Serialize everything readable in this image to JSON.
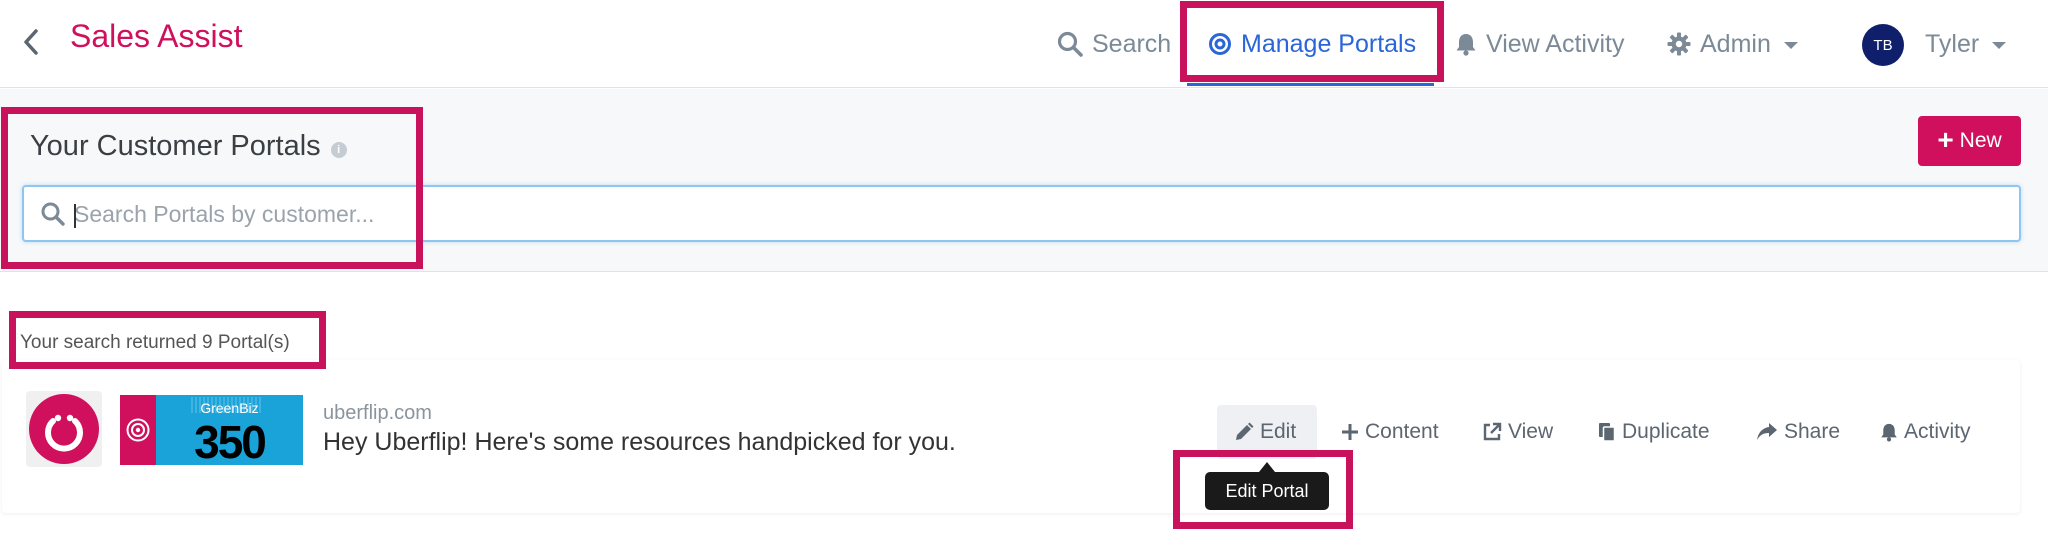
{
  "app": {
    "title": "Sales Assist"
  },
  "nav": {
    "search": "Search",
    "manage_portals": "Manage Portals",
    "view_activity": "View Activity",
    "admin": "Admin",
    "user_initials": "TB",
    "user_name": "Tyler"
  },
  "portals": {
    "title": "Your Customer Portals",
    "info_glyph": "i",
    "new_label": "New",
    "search_placeholder": "Search Portals by customer...",
    "search_value": "",
    "results_text": "Your search returned 9 Portal(s)"
  },
  "portal_card": {
    "domain": "uberflip.com",
    "description": "Hey Uberflip! Here's some resources handpicked for you.",
    "banner_name": "GreenBiz",
    "banner_number": "350"
  },
  "actions": {
    "edit": "Edit",
    "content": "Content",
    "view": "View",
    "duplicate": "Duplicate",
    "share": "Share",
    "activity": "Activity"
  },
  "tooltip": {
    "edit": "Edit Portal"
  },
  "colors": {
    "brand": "#d0105d",
    "active_nav": "#2a66d8",
    "highlight": "#c8125c",
    "avatar": "#0f1f6b"
  }
}
